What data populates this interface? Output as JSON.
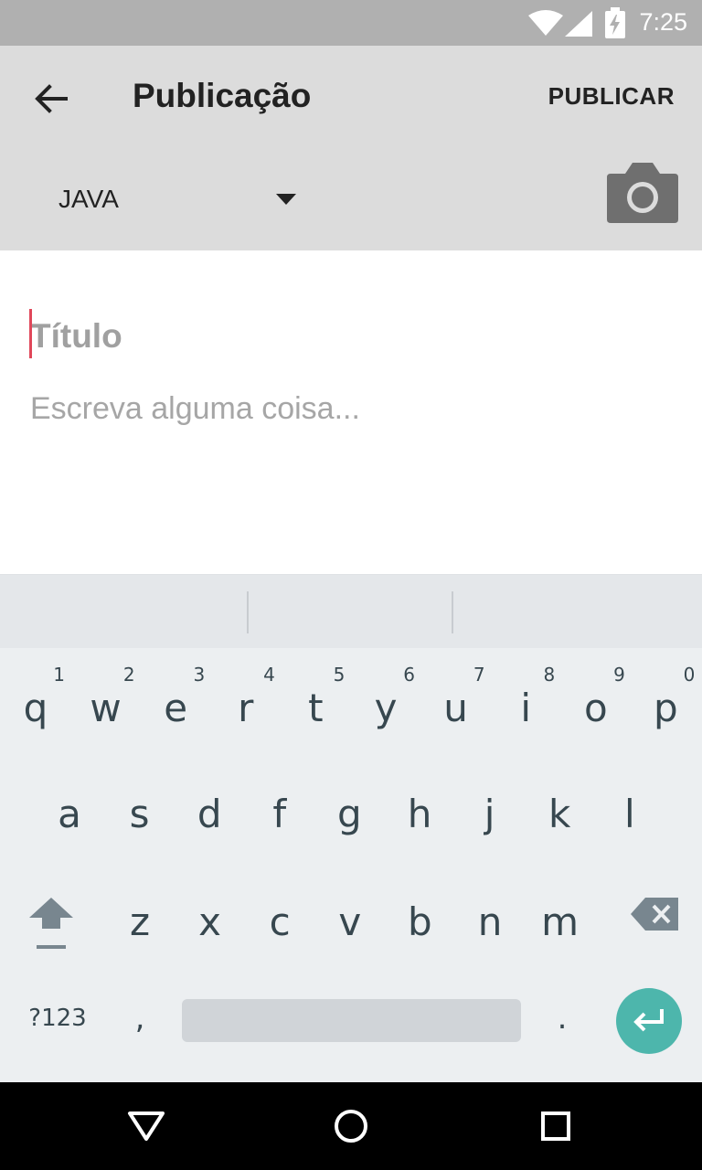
{
  "status_bar": {
    "time": "7:25",
    "icons": [
      "wifi-icon",
      "signal-icon",
      "battery-charging-icon"
    ]
  },
  "app_bar": {
    "title": "Publicação",
    "back_icon": "arrow-back-icon",
    "action_label": "PUBLICAR",
    "category": {
      "selected": "JAVA",
      "icon": "dropdown-arrow-icon"
    },
    "camera_icon": "camera-icon"
  },
  "editor": {
    "title_placeholder": "Título",
    "title_value": "",
    "body_placeholder": "Escreva alguma coisa...",
    "body_value": ""
  },
  "keyboard": {
    "row1": [
      {
        "key": "q",
        "hint": "1"
      },
      {
        "key": "w",
        "hint": "2"
      },
      {
        "key": "e",
        "hint": "3"
      },
      {
        "key": "r",
        "hint": "4"
      },
      {
        "key": "t",
        "hint": "5"
      },
      {
        "key": "y",
        "hint": "6"
      },
      {
        "key": "u",
        "hint": "7"
      },
      {
        "key": "i",
        "hint": "8"
      },
      {
        "key": "o",
        "hint": "9"
      },
      {
        "key": "p",
        "hint": "0"
      }
    ],
    "row2": [
      "a",
      "s",
      "d",
      "f",
      "g",
      "h",
      "j",
      "k",
      "l"
    ],
    "row3": [
      "z",
      "x",
      "c",
      "v",
      "b",
      "n",
      "m"
    ],
    "symbols_label": "?123",
    "comma_label": ",",
    "period_label": ".",
    "shift_icon": "shift-icon",
    "backspace_icon": "backspace-icon",
    "enter_icon": "enter-icon",
    "accent_color": "#4db6ac"
  },
  "nav_bar": {
    "icons": [
      "back-triangle-icon",
      "home-circle-icon",
      "recents-square-icon"
    ]
  },
  "colors": {
    "status_bar": "#b0b0b0",
    "app_bar": "#dcdcdc",
    "cursor": "#e0475a",
    "keyboard": "#eceff1"
  }
}
